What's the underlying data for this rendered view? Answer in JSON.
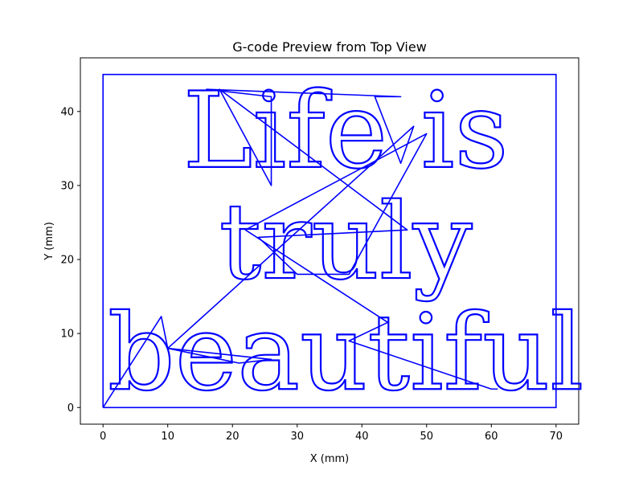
{
  "chart_data": {
    "type": "line",
    "title": "G-code Preview from Top View",
    "xlabel": "X (mm)",
    "ylabel": "Y (mm)",
    "xlim": [
      -3.5,
      73.5
    ],
    "ylim": [
      -2.25,
      47.25
    ],
    "xticks": [
      0,
      10,
      20,
      30,
      40,
      50,
      60,
      70
    ],
    "yticks": [
      0,
      10,
      20,
      30,
      40
    ],
    "series_color": "#0000ff",
    "grid": false,
    "border": {
      "x": [
        0,
        70,
        70,
        0,
        0
      ],
      "y": [
        0,
        0,
        45,
        45,
        0
      ]
    },
    "text_lines": [
      {
        "text": "Life is",
        "x_center": 37.5,
        "baseline_y": 32.5,
        "cap_height": 10
      },
      {
        "text": "truly",
        "x_center": 37.5,
        "baseline_y": 17.5,
        "cap_height": 10
      },
      {
        "text": "beautiful",
        "x_center": 37.5,
        "baseline_y": 2.5,
        "cap_height": 10
      }
    ],
    "travel_path": {
      "x": [
        0,
        9,
        10,
        21,
        26,
        10,
        48,
        46,
        42,
        46,
        16,
        26,
        26,
        18,
        47,
        24,
        30,
        38,
        50,
        22,
        44,
        38,
        60,
        61
      ],
      "y": [
        0,
        12.3,
        8,
        6,
        6.5,
        8,
        38,
        33,
        42,
        42,
        43,
        42,
        30,
        43,
        24,
        23,
        18,
        18,
        37,
        24,
        11.5,
        9,
        2.5,
        2.5
      ]
    }
  }
}
